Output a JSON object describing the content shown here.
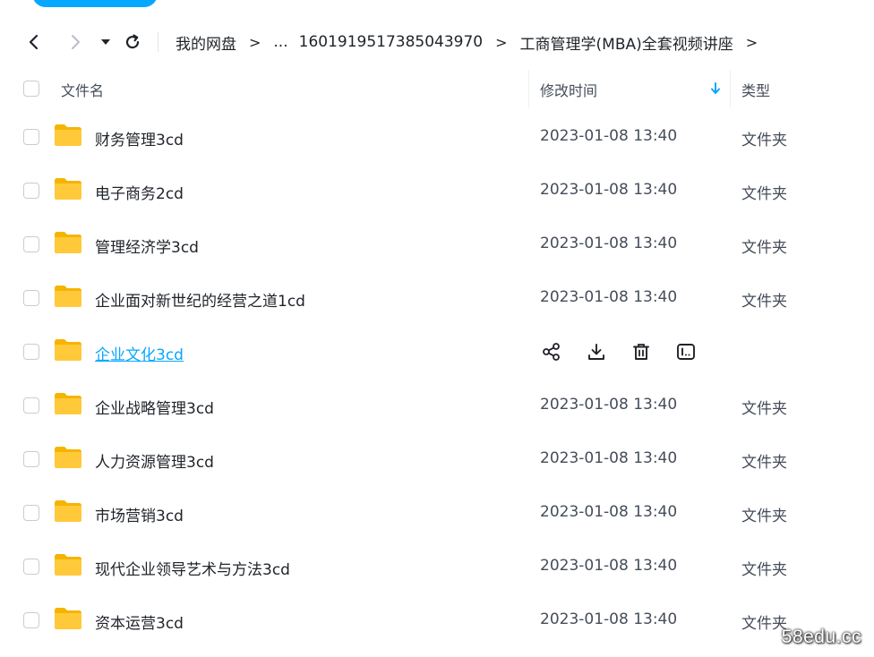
{
  "nav": {
    "breadcrumbs": [
      "我的网盘",
      "...",
      "1601919517385043970",
      "工商管理学(MBA)全套视频讲座"
    ],
    "separator": ">"
  },
  "columns": {
    "name": "文件名",
    "modified": "修改时间",
    "type": "类型"
  },
  "colors": {
    "accent": "#06a7ff",
    "folder": "#ffc93a",
    "folder_back": "#f5b400"
  },
  "files": [
    {
      "name": "财务管理3cd",
      "date": "2023-01-08 13:40",
      "type": "文件夹"
    },
    {
      "name": "电子商务2cd",
      "date": "2023-01-08 13:40",
      "type": "文件夹"
    },
    {
      "name": "管理经济学3cd",
      "date": "2023-01-08 13:40",
      "type": "文件夹"
    },
    {
      "name": "企业面对新世纪的经营之道1cd",
      "date": "2023-01-08 13:40",
      "type": "文件夹"
    },
    {
      "name": "企业文化3cd",
      "hover": true,
      "actions": [
        "share-icon",
        "download-icon",
        "delete-icon",
        "rename-icon"
      ]
    },
    {
      "name": "企业战略管理3cd",
      "date": "2023-01-08 13:40",
      "type": "文件夹"
    },
    {
      "name": "人力资源管理3cd",
      "date": "2023-01-08 13:40",
      "type": "文件夹"
    },
    {
      "name": "市场营销3cd",
      "date": "2023-01-08 13:40",
      "type": "文件夹"
    },
    {
      "name": "现代企业领导艺术与方法3cd",
      "date": "2023-01-08 13:40",
      "type": "文件夹"
    },
    {
      "name": "资本运营3cd",
      "date": "2023-01-08 13:40",
      "type": "文件夹"
    }
  ],
  "watermark": "58edu.cc"
}
